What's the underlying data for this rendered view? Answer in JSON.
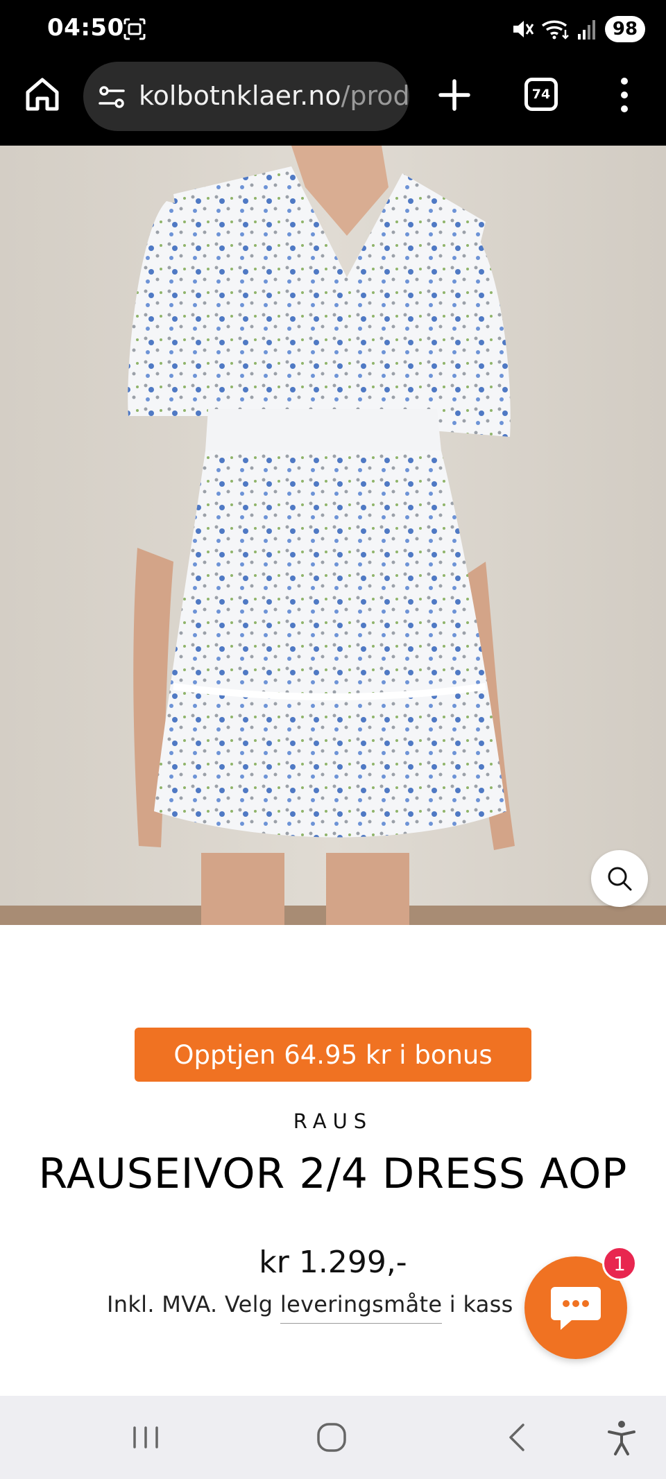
{
  "status_bar": {
    "time": "04:50",
    "battery": "98",
    "icons": [
      "screenshot-icon",
      "mute-icon",
      "wifi-icon",
      "signal-icon"
    ]
  },
  "browser": {
    "url_host": "kolbotnklaer.no",
    "url_path": "/prod",
    "tab_count": "74",
    "icons": [
      "home-icon",
      "site-settings-icon",
      "plus-icon",
      "tabs-icon",
      "more-vert-icon"
    ]
  },
  "product": {
    "bonus_text": "Opptjen 64.95 kr i bonus",
    "brand": "RAUS",
    "title": "RAUSEIVOR 2/4 DRESS AOP",
    "price": "kr 1.299,-",
    "tax_prefix": "Inkl. MVA. Velg ",
    "tax_link": "leveringsmåte",
    "tax_suffix": " i kass"
  },
  "chat": {
    "unread_count": "1",
    "icon": "chat-bubble-icon"
  },
  "nav": {
    "icons": [
      "recent-apps-icon",
      "home-circle-icon",
      "back-icon",
      "accessibility-icon"
    ]
  },
  "colors": {
    "accent": "#f07222",
    "badge": "#e8264f",
    "browser_bg": "#000000",
    "url_pill": "#2b2b2b",
    "nav_bg": "#eeeef2"
  }
}
